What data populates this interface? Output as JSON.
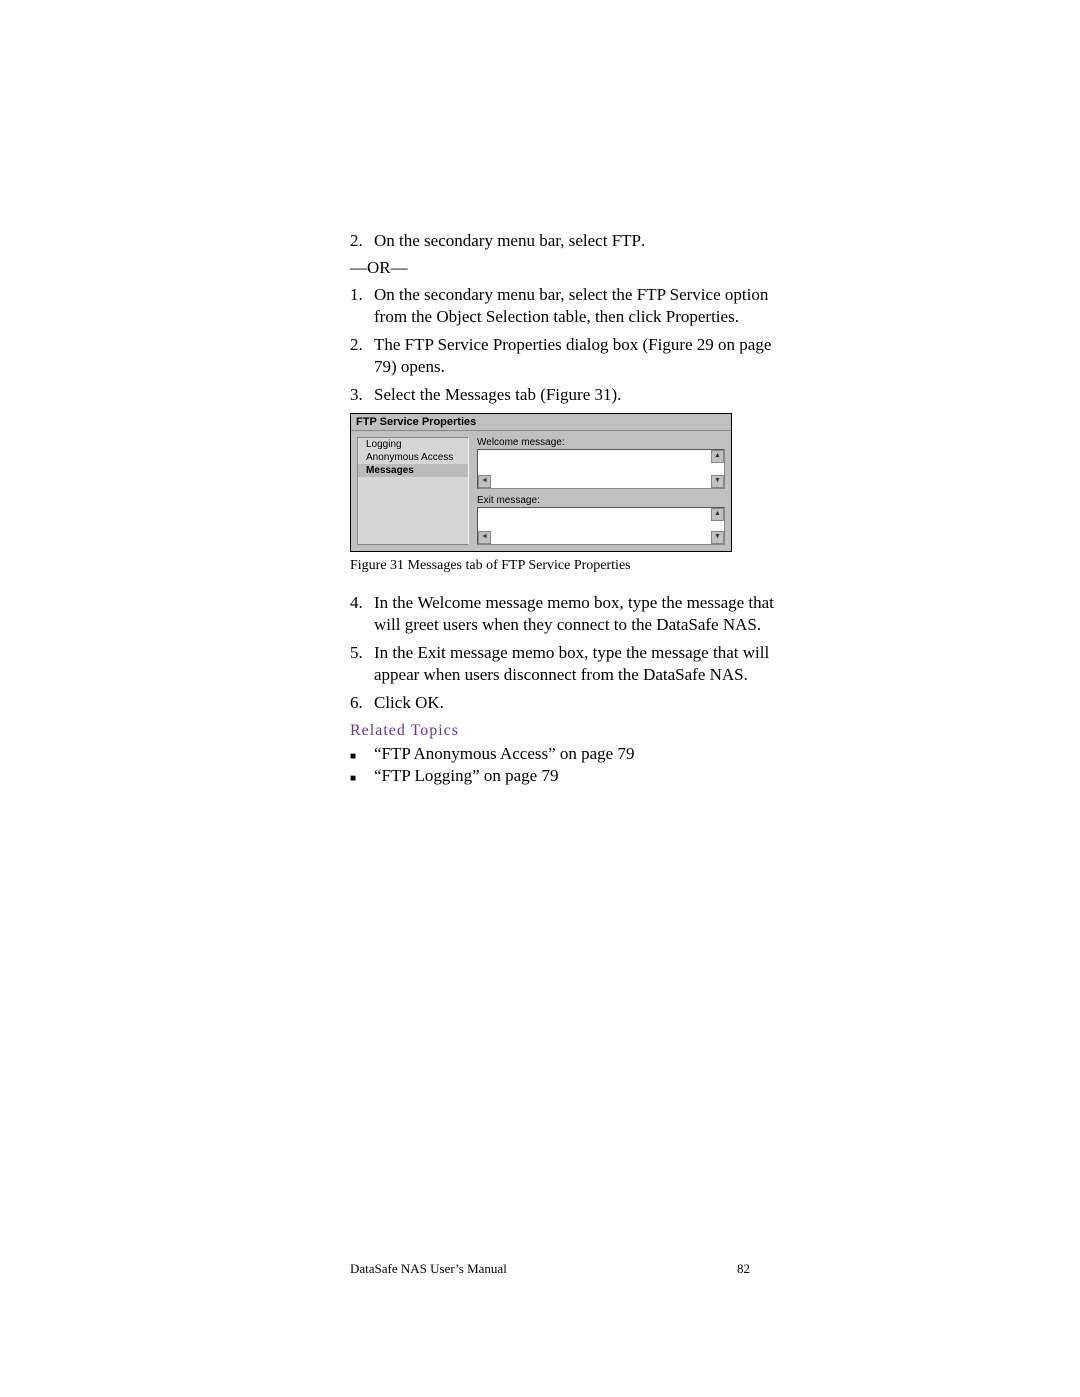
{
  "steps_a": {
    "n2": "2.",
    "t2_a": "On the secondary menu bar, select ",
    "t2_b": "FTP",
    "t2_c": "."
  },
  "or": "—OR—",
  "steps_b": {
    "n1": "1.",
    "t1_a": "On the secondary menu bar, select the ",
    "t1_b": "FTP Service",
    "t1_c": " option from the ",
    "t1_d": "Object Selection",
    "t1_e": " table, then click ",
    "t1_f": "Properties",
    "t1_g": ".",
    "n2": "2.",
    "t2": "The FTP Service Properties dialog box (Figure 29 on page 79) opens.",
    "n3": "3.",
    "t3_a": "Select the ",
    "t3_b": "Messages",
    "t3_c": " tab (Figure 31)."
  },
  "dialog": {
    "title": "FTP Service Properties",
    "tabs": {
      "logging": "Logging",
      "anon": "Anonymous Access",
      "messages": "Messages"
    },
    "lbl_welcome": "Welcome message:",
    "lbl_exit": "Exit message:"
  },
  "fig_caption": "Figure 31   Messages tab of FTP Service Properties",
  "steps_c": {
    "n4": "4.",
    "t4_a": "In the ",
    "t4_b": "Welcome message",
    "t4_c": " memo box, type the message that will greet users when they connect to the DataSafe NAS.",
    "n5": "5.",
    "t5_a": "In the ",
    "t5_b": "Exit message",
    "t5_c": " memo box, type the message that will appear when users disconnect from the DataSafe NAS.",
    "n6": "6.",
    "t6_a": "Click ",
    "t6_b": "OK",
    "t6_c": "."
  },
  "related": {
    "heading": "Related Topics",
    "i1": "“FTP Anonymous Access” on page 79",
    "i2": "“FTP Logging” on page 79",
    "bullet": "■"
  },
  "footer": {
    "left": "DataSafe NAS User’s Manual",
    "right": "82"
  }
}
